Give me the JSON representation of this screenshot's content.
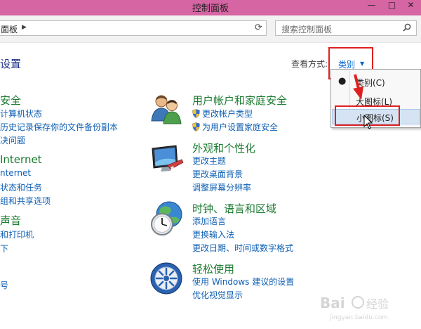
{
  "window": {
    "title": "控制面板"
  },
  "address": {
    "crumb": "面板",
    "search_placeholder": "搜索控制面板"
  },
  "page": {
    "heading": "设置",
    "view_by_label": "查看方式:",
    "view_by_value": "类别"
  },
  "view_menu": {
    "items": [
      "类别(C)",
      "大图标(L)",
      "小图标(S)"
    ],
    "checked_index": 0,
    "highlight_index": 2
  },
  "left_column": {
    "categories": [
      {
        "title": "安全",
        "links": [
          "计算机状态",
          "历史记录保存你的文件备份副本",
          "决问题"
        ]
      },
      {
        "title": "Internet",
        "links": [
          "nternet",
          "状态和任务",
          "组和共享选项"
        ]
      },
      {
        "title": "声音",
        "links": [
          "和打印机",
          "下"
        ]
      },
      {
        "title": "",
        "links": [
          "号"
        ]
      }
    ]
  },
  "right_column": {
    "categories": [
      {
        "title": "用户帐户和家庭安全",
        "icon": "users-icon",
        "links": [
          "更改帐户类型",
          "为用户设置家庭安全"
        ]
      },
      {
        "title": "外观和个性化",
        "icon": "monitor-icon",
        "links": [
          "更改主题",
          "更改桌面背景",
          "调整屏幕分辨率"
        ]
      },
      {
        "title": "时钟、语言和区域",
        "icon": "globe-clock-icon",
        "links": [
          "添加语言",
          "更换输入法",
          "更改日期、时间或数字格式"
        ]
      },
      {
        "title": "轻松使用",
        "icon": "ease-of-access-icon",
        "links": [
          "使用 Windows 建议的设置",
          "优化视觉显示"
        ]
      }
    ]
  },
  "colors": {
    "title_bar": "#d665a4",
    "category_title": "#1a7a2e",
    "link": "#0e5fb3",
    "highlight_box": "#e02020"
  }
}
